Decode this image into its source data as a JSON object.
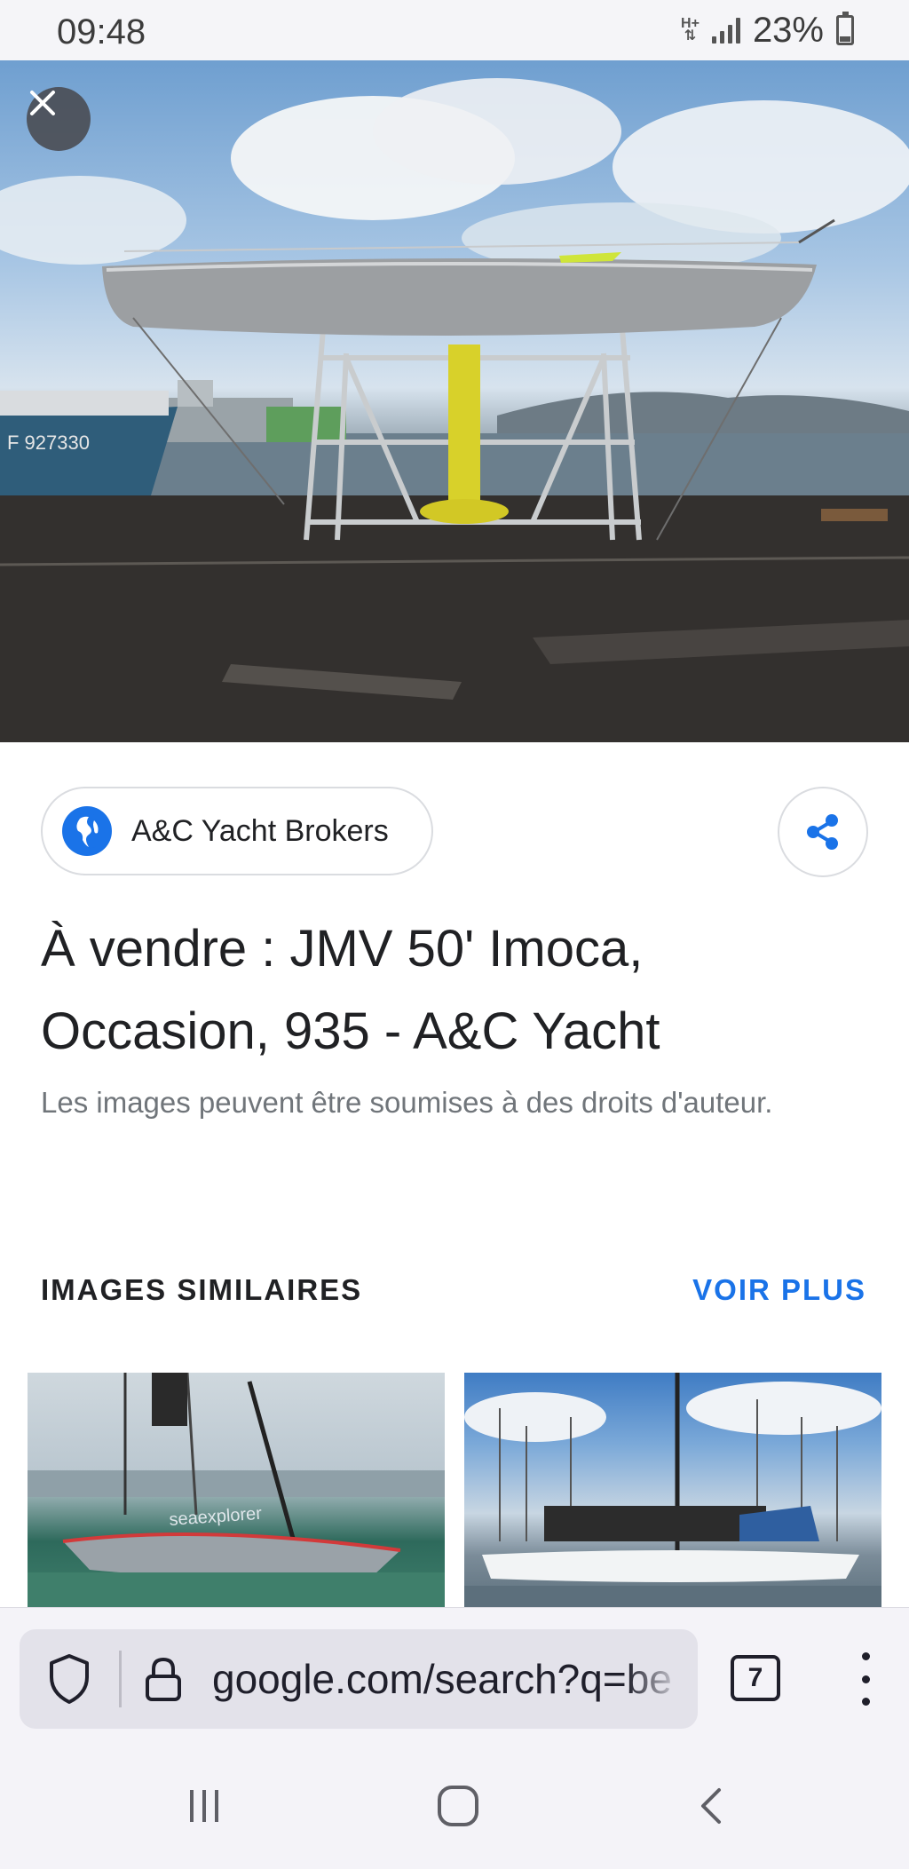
{
  "status_bar": {
    "time": "09:48",
    "network_type": "H+",
    "battery_percent": "23%",
    "battery_level": 0.23
  },
  "hero": {
    "close_icon": "close-icon",
    "hull_text": "F 927330"
  },
  "source": {
    "name": "A&C Yacht Brokers",
    "icon": "globe-icon",
    "share_icon": "share-icon"
  },
  "result": {
    "title": "À vendre : JMV 50' Imoca, Occasion, 935 - A&C Yacht",
    "copyright_notice": "Les images peuvent être soumises à des droits d'auteur."
  },
  "similar": {
    "header": "IMAGES SIMILAIRES",
    "see_more": "VOIR PLUS"
  },
  "browser": {
    "url": "google.com/search?q=be",
    "tab_count": "7",
    "shield_icon": "shield-icon",
    "lock_icon": "lock-icon",
    "menu_icon": "more-vert-icon"
  },
  "navigation": {
    "recents_icon": "recents-icon",
    "home_icon": "home-icon",
    "back_icon": "back-icon"
  },
  "colors": {
    "accent": "#1a73e8",
    "text_primary": "#202124",
    "text_secondary": "#70757a",
    "bar_background": "#f4f3f8"
  }
}
